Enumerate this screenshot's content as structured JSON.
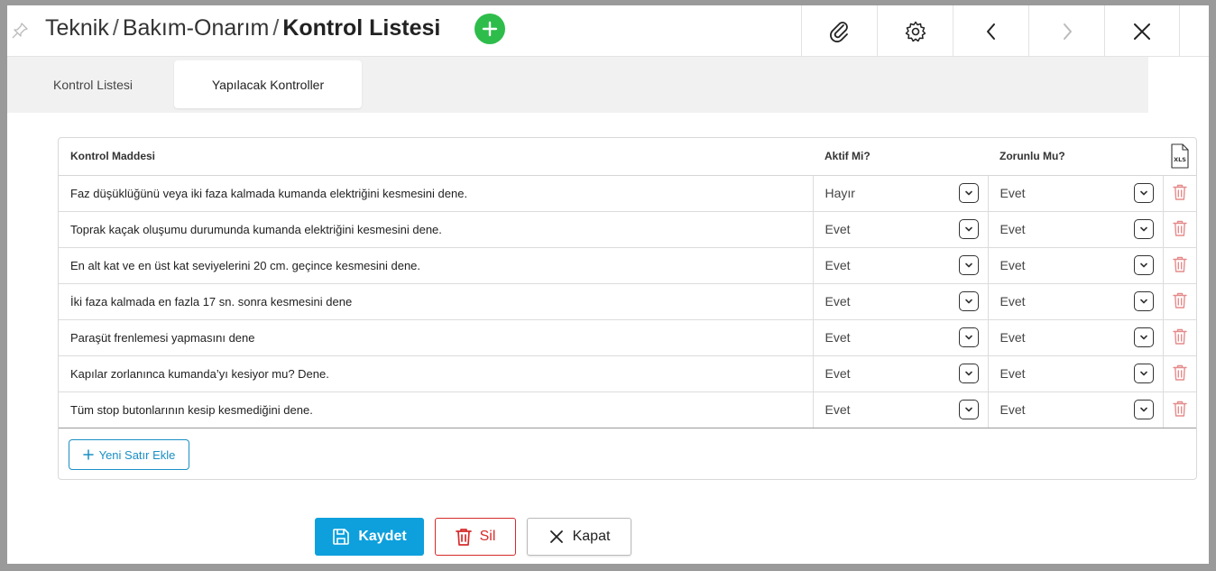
{
  "header": {
    "breadcrumb": [
      "Teknik",
      "Bakım-Onarım"
    ],
    "separator": "/",
    "current": "Kontrol Listesi",
    "toolbar_icons": [
      "paperclip-icon",
      "gear-icon",
      "chevron-left-icon",
      "chevron-right-icon",
      "close-icon"
    ]
  },
  "tabs": [
    {
      "label": "Kontrol Listesi",
      "active": false
    },
    {
      "label": "Yapılacak Kontroller",
      "active": true
    }
  ],
  "table": {
    "columns": [
      "Kontrol Maddesi",
      "Aktif Mi?",
      "Zorunlu Mu?"
    ],
    "export_icon_label": "XLS",
    "rows": [
      {
        "item": "Faz düşüklüğünü veya iki faza kalmada kumanda elektriğini kesmesini dene.",
        "aktif": "Hayır",
        "zorunlu": "Evet"
      },
      {
        "item": "Toprak kaçak oluşumu durumunda kumanda elektriğini kesmesini dene.",
        "aktif": "Evet",
        "zorunlu": "Evet"
      },
      {
        "item": "En alt kat ve en üst kat seviyelerini 20 cm. geçince kesmesini dene.",
        "aktif": "Evet",
        "zorunlu": "Evet"
      },
      {
        "item": "İki faza kalmada en fazla 17 sn. sonra kesmesini dene",
        "aktif": "Evet",
        "zorunlu": "Evet"
      },
      {
        "item": "Paraşüt frenlemesi yapmasını dene",
        "aktif": "Evet",
        "zorunlu": "Evet"
      },
      {
        "item": "Kapılar zorlanınca kumanda’yı kesiyor mu? Dene.",
        "aktif": "Evet",
        "zorunlu": "Evet"
      },
      {
        "item": "Tüm stop butonlarının kesip kesmediğini dene.",
        "aktif": "Evet",
        "zorunlu": "Evet"
      }
    ],
    "add_row_label": "Yeni Satır Ekle"
  },
  "footer": {
    "save_label": "Kaydet",
    "delete_label": "Sil",
    "close_label": "Kapat"
  },
  "colors": {
    "accent": "#0ea0dc",
    "add_green": "#2ebd4a",
    "danger": "#d62b2b",
    "trash": "#e58b8b"
  }
}
